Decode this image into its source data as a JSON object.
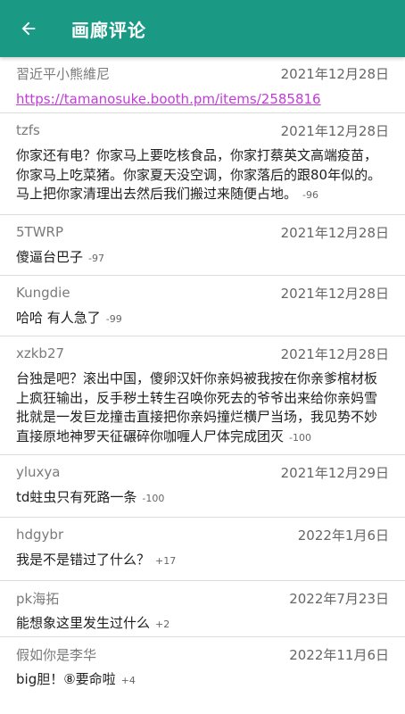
{
  "header": {
    "title": "画廊评论",
    "back_icon": "arrow-left-icon"
  },
  "colors": {
    "appbar": "#1a9a85",
    "link": "#c23bd9"
  },
  "comments": [
    {
      "user": "習近平小熊維尼",
      "date": "2021年12月28日",
      "link": "https://tamanosuke.booth.pm/items/2585816"
    },
    {
      "user": "tzfs",
      "date": "2021年12月28日",
      "text": "你家还有电？你家马上要吃核食品，你家打蔡英文高端疫苗，你家马上吃菜猪。你家夏天没空调，你家落后的跟80年似的。马上把你家清理出去然后我们搬过来随便占地。",
      "score": "-96"
    },
    {
      "user": "5TWRP",
      "date": "2021年12月28日",
      "text": "傻逼台巴子",
      "score": "-97"
    },
    {
      "user": "Kungdie",
      "date": "2021年12月28日",
      "text": "哈哈 有人急了",
      "score": "-99"
    },
    {
      "user": "xzkb27",
      "date": "2021年12月28日",
      "text": "台独是吧？滚出中国，傻卵汉奸你亲妈被我按在你亲爹棺材板上疯狂输出，反手秽土转生召唤你死去的爷爷出来给你亲妈雪批就是一发巨龙撞击直接把你亲妈撞烂横尸当场，我见势不妙直接原地神罗天征碾碎你咖喱人尸体完成团灭",
      "score": "-100"
    },
    {
      "user": "yluxya",
      "date": "2021年12月29日",
      "text": "td蛀虫只有死路一条",
      "score": "-100"
    },
    {
      "user": "hdgybr",
      "date": "2022年1月6日",
      "text": "我是不是错过了什么？",
      "score": "+17"
    },
    {
      "user": "pk海拓",
      "date": "2022年7月23日",
      "text": "能想象这里发生过什么",
      "score": "+2"
    },
    {
      "user": "假如你是李华",
      "date": "2022年11月6日",
      "text": "big胆！⑧要命啦",
      "score": "+4"
    }
  ]
}
